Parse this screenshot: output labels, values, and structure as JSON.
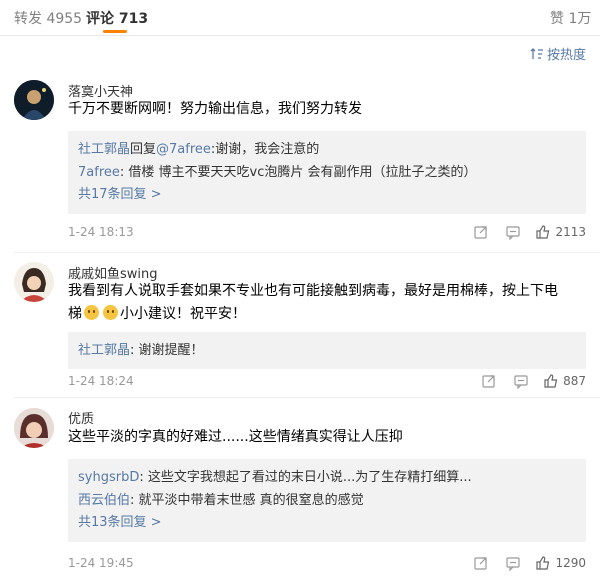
{
  "tabs": {
    "repost_label": "转发",
    "repost_count": "4955",
    "comment_label": "评论",
    "comment_count": "713",
    "like_label": "赞",
    "like_count": "1万"
  },
  "sort": {
    "label": "按热度"
  },
  "accent_color": "#ff8200",
  "link_color": "#5779a6",
  "comments": [
    {
      "username": "落寞小天神",
      "text": "千万不要断网啊！努力输出信息，我们努力转发",
      "replies": [
        {
          "name": "社工郭晶",
          "prefix": "回复",
          "mention": "@7afree",
          "text": ":谢谢，我会注意的"
        },
        {
          "name": "7afree",
          "text": ": 借楼 博主不要天天吃vc泡腾片 会有副作用（拉肚子之类的）"
        }
      ],
      "more_replies": "共17条回复 >",
      "time": "1-24 18:13",
      "likes": "2113"
    },
    {
      "username": "戚戚如鱼swing",
      "text_line1": "我看到有人说取手套如果不专业也有可能接触到病毒，最好是用棉棒，按上下电",
      "text_line2_a": "梯",
      "text_line2_b": "小小建议！祝平安！",
      "emoji_name": "emoji-face-icon",
      "replies": [
        {
          "name": "社工郭晶",
          "text": ": 谢谢提醒！"
        }
      ],
      "time": "1-24 18:24",
      "likes": "887"
    },
    {
      "username": "优质",
      "text": "这些平淡的字真的好难过......这些情绪真实得让人压抑",
      "replies": [
        {
          "name": "syhgsrbD",
          "text": ": 这些文字我想起了看过的末日小说...为了生存精打细算..."
        },
        {
          "name": "西云伯伯",
          "text": ": 就平淡中带着末世感 真的很窒息的感觉"
        }
      ],
      "more_replies": "共13条回复 >",
      "time": "1-24 19:45",
      "likes": "1290"
    }
  ]
}
